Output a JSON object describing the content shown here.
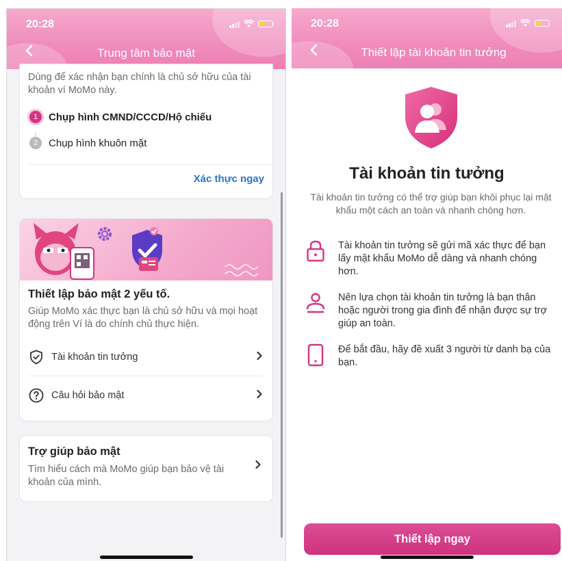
{
  "left_screen": {
    "status_time": "20:28",
    "title": "Trung tâm bảo mật",
    "verify": {
      "description": "Dùng để xác nhận bạn chính là chủ sở hữu của tài khoản ví MoMo này.",
      "steps": [
        {
          "num": "1",
          "label": "Chụp hình CMND/CCCD/Hộ chiếu"
        },
        {
          "num": "2",
          "label": "Chụp hình khuôn mặt"
        }
      ],
      "action_label": "Xác thực ngay"
    },
    "twofa": {
      "title": "Thiết lập bảo mật 2 yếu tố.",
      "description": "Giúp MoMo xác thực bạn là chủ sở hữu và mọi hoạt động trên Ví là do chính chủ thực hiện.",
      "items": [
        {
          "label": "Tài khoản tin tưởng",
          "icon": "shield-check-icon"
        },
        {
          "label": "Câu hỏi bảo mật",
          "icon": "question-circle-icon"
        }
      ]
    },
    "help": {
      "title": "Trợ giúp bảo mật",
      "description": "Tìm hiểu cách mà MoMo giúp bạn bảo vệ tài khoản của mình."
    }
  },
  "right_screen": {
    "status_time": "20:28",
    "title": "Thiết lập tài khoản tin tưởng",
    "heading": "Tài khoản tin tưởng",
    "description": "Tài khoản tin tưởng có thể trợ giúp bạn khôi phục lại mật khẩu một cách an toàn và nhanh chóng hơn.",
    "features": [
      {
        "icon": "lock-icon",
        "text": "Tài khoản tin tưởng sẽ gửi mã xác thực để bạn lấy mật khẩu MoMo dễ dàng và nhanh chóng hơn."
      },
      {
        "icon": "person-icon",
        "text": "Nên lựa chọn tài khoản tin tưởng là bạn thân hoặc người trong gia đình để nhận được sự trợ giúp an toàn."
      },
      {
        "icon": "phone-icon",
        "text": "Để bắt đầu, hãy đề xuất 3 người từ danh bạ của bạn."
      }
    ],
    "cta_label": "Thiết lập ngay"
  },
  "colors": {
    "accent": "#d63384",
    "link": "#2d72d2",
    "header_pink": "#f08cbc"
  }
}
